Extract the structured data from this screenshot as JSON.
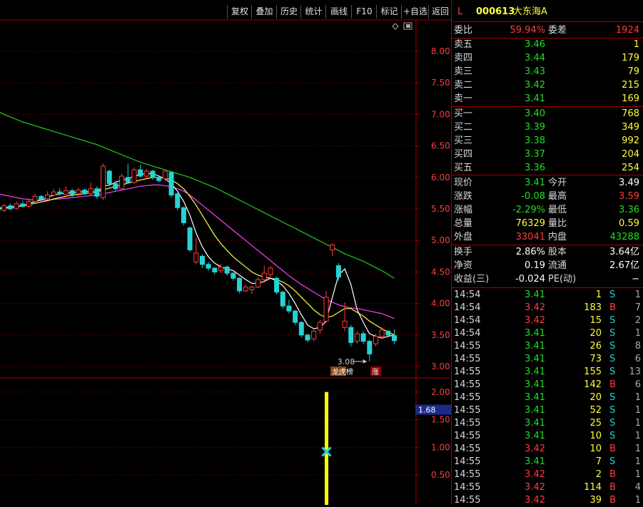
{
  "toolbar": {
    "buttons": [
      "复权",
      "叠加",
      "历史",
      "统计",
      "画线",
      "F10",
      "标记",
      "+自选",
      "返回"
    ]
  },
  "stock": {
    "flag": "L",
    "code": "000613",
    "name": "大东海A"
  },
  "order_ratio": {
    "label1": "委比",
    "value1": "59.94%",
    "label2": "委差",
    "value2": "1924"
  },
  "asks": [
    {
      "label": "卖五",
      "price": "3.46",
      "volume": "1"
    },
    {
      "label": "卖四",
      "price": "3.44",
      "volume": "179"
    },
    {
      "label": "卖三",
      "price": "3.43",
      "volume": "79"
    },
    {
      "label": "卖二",
      "price": "3.42",
      "volume": "215"
    },
    {
      "label": "卖一",
      "price": "3.41",
      "volume": "169"
    }
  ],
  "bids": [
    {
      "label": "买一",
      "price": "3.40",
      "volume": "768"
    },
    {
      "label": "买二",
      "price": "3.39",
      "volume": "349"
    },
    {
      "label": "买三",
      "price": "3.38",
      "volume": "992"
    },
    {
      "label": "买四",
      "price": "3.37",
      "volume": "204"
    },
    {
      "label": "买五",
      "price": "3.36",
      "volume": "254"
    }
  ],
  "stats1": [
    {
      "l1": "现价",
      "v1": "3.41",
      "c1": "green",
      "l2": "今开",
      "v2": "3.49",
      "c2": "white"
    },
    {
      "l1": "涨跌",
      "v1": "-0.08",
      "c1": "green",
      "l2": "最高",
      "v2": "3.59",
      "c2": "red"
    },
    {
      "l1": "涨幅",
      "v1": "-2.29%",
      "c1": "green",
      "l2": "最低",
      "v2": "3.36",
      "c2": "green"
    },
    {
      "l1": "总量",
      "v1": "76329",
      "c1": "yellow",
      "l2": "量比",
      "v2": "0.59",
      "c2": "yellow"
    },
    {
      "l1": "外盘",
      "v1": "33041",
      "c1": "red",
      "l2": "内盘",
      "v2": "43288",
      "c2": "green"
    }
  ],
  "stats2": [
    {
      "l1": "换手",
      "v1": "2.86%",
      "l2": "股本",
      "v2": "3.64亿"
    },
    {
      "l1": "净资",
      "v1": "0.19",
      "l2": "流通",
      "v2": "2.67亿"
    },
    {
      "l1": "收益(三)",
      "v1": "-0.024",
      "l2": "PE(动)",
      "v2": "−"
    }
  ],
  "ticks": [
    {
      "time": "14:54",
      "price": "3.41",
      "vol": "1",
      "side": "S",
      "n": "1"
    },
    {
      "time": "14:54",
      "price": "3.42",
      "vol": "183",
      "side": "B",
      "n": "7"
    },
    {
      "time": "14:54",
      "price": "3.42",
      "vol": "15",
      "side": "S",
      "n": "2"
    },
    {
      "time": "14:54",
      "price": "3.41",
      "vol": "20",
      "side": "S",
      "n": "1"
    },
    {
      "time": "14:55",
      "price": "3.41",
      "vol": "26",
      "side": "S",
      "n": "8"
    },
    {
      "time": "14:55",
      "price": "3.41",
      "vol": "73",
      "side": "S",
      "n": "6"
    },
    {
      "time": "14:55",
      "price": "3.41",
      "vol": "155",
      "side": "S",
      "n": "13"
    },
    {
      "time": "14:55",
      "price": "3.41",
      "vol": "142",
      "side": "B",
      "n": "6"
    },
    {
      "time": "14:55",
      "price": "3.41",
      "vol": "20",
      "side": "S",
      "n": "1"
    },
    {
      "time": "14:55",
      "price": "3.41",
      "vol": "52",
      "side": "S",
      "n": "1"
    },
    {
      "time": "14:55",
      "price": "3.41",
      "vol": "25",
      "side": "S",
      "n": "1"
    },
    {
      "time": "14:55",
      "price": "3.41",
      "vol": "10",
      "side": "S",
      "n": "1"
    },
    {
      "time": "14:55",
      "price": "3.42",
      "vol": "10",
      "side": "B",
      "n": "1"
    },
    {
      "time": "14:55",
      "price": "3.41",
      "vol": "7",
      "side": "S",
      "n": "1"
    },
    {
      "time": "14:55",
      "price": "3.42",
      "vol": "2",
      "side": "B",
      "n": "1"
    },
    {
      "time": "14:55",
      "price": "3.42",
      "vol": "114",
      "side": "B",
      "n": "4"
    },
    {
      "time": "14:55",
      "price": "3.42",
      "vol": "39",
      "side": "B",
      "n": "1"
    }
  ],
  "colors": {
    "up": "#ff3c3c",
    "down": "#27d2d2",
    "ma5": "#ffffff",
    "ma10": "#ffff3c",
    "ma20": "#ff3cff",
    "ma60": "#22cc22",
    "grid": "#a00000",
    "indicator": "#ffff00"
  },
  "chart_data": [
    {
      "type": "candlestick",
      "price_axis": {
        "ticks": [
          "8.00",
          "7.50",
          "7.00",
          "6.50",
          "6.00",
          "5.50",
          "5.00",
          "4.50",
          "4.00",
          "3.50",
          "3.00"
        ],
        "ylim": [
          2.9,
          8.3
        ]
      },
      "annotations": {
        "low_label": "3.08",
        "badge1": "龙虎榜",
        "badge2": "涨"
      },
      "candles": [
        {
          "o": 5.52,
          "c": 5.47,
          "h": 5.56,
          "l": 5.44
        },
        {
          "o": 5.48,
          "c": 5.55,
          "h": 5.58,
          "l": 5.45
        },
        {
          "o": 5.55,
          "c": 5.5,
          "h": 5.59,
          "l": 5.48
        },
        {
          "o": 5.51,
          "c": 5.58,
          "h": 5.62,
          "l": 5.49
        },
        {
          "o": 5.58,
          "c": 5.54,
          "h": 5.63,
          "l": 5.52
        },
        {
          "o": 5.54,
          "c": 5.62,
          "h": 5.66,
          "l": 5.52
        },
        {
          "o": 5.62,
          "c": 5.7,
          "h": 5.74,
          "l": 5.6
        },
        {
          "o": 5.7,
          "c": 5.65,
          "h": 5.72,
          "l": 5.6
        },
        {
          "o": 5.66,
          "c": 5.72,
          "h": 5.78,
          "l": 5.64
        },
        {
          "o": 5.72,
          "c": 5.77,
          "h": 5.82,
          "l": 5.7
        },
        {
          "o": 5.77,
          "c": 5.74,
          "h": 5.83,
          "l": 5.71
        },
        {
          "o": 5.73,
          "c": 5.79,
          "h": 5.86,
          "l": 5.7
        },
        {
          "o": 5.79,
          "c": 5.73,
          "h": 5.82,
          "l": 5.69
        },
        {
          "o": 5.74,
          "c": 5.8,
          "h": 5.84,
          "l": 5.7
        },
        {
          "o": 5.8,
          "c": 5.74,
          "h": 5.82,
          "l": 5.72
        },
        {
          "o": 5.74,
          "c": 5.82,
          "h": 5.92,
          "l": 5.72
        },
        {
          "o": 5.82,
          "c": 5.7,
          "h": 5.86,
          "l": 5.66
        },
        {
          "o": 5.68,
          "c": 6.18,
          "h": 6.22,
          "l": 5.64
        },
        {
          "o": 6.1,
          "c": 5.9,
          "h": 6.12,
          "l": 5.86
        },
        {
          "o": 5.9,
          "c": 5.82,
          "h": 5.95,
          "l": 5.78
        },
        {
          "o": 5.82,
          "c": 6.02,
          "h": 6.06,
          "l": 5.8
        },
        {
          "o": 6.0,
          "c": 5.92,
          "h": 6.22,
          "l": 5.9
        },
        {
          "o": 5.92,
          "c": 6.12,
          "h": 6.16,
          "l": 5.9
        },
        {
          "o": 6.12,
          "c": 6.02,
          "h": 6.2,
          "l": 6.0
        },
        {
          "o": 6.02,
          "c": 6.1,
          "h": 6.14,
          "l": 5.98
        },
        {
          "o": 6.1,
          "c": 6.0,
          "h": 6.12,
          "l": 5.96
        },
        {
          "o": 6.0,
          "c": 5.95,
          "h": 6.04,
          "l": 5.92
        },
        {
          "o": 5.98,
          "c": 6.1,
          "h": 6.12,
          "l": 5.94
        },
        {
          "o": 6.08,
          "c": 5.72,
          "h": 6.1,
          "l": 5.68
        },
        {
          "o": 5.74,
          "c": 5.52,
          "h": 5.76,
          "l": 5.48
        },
        {
          "o": 5.52,
          "c": 5.28,
          "h": 5.54,
          "l": 5.24
        },
        {
          "o": 5.2,
          "c": 4.85,
          "h": 5.22,
          "l": 4.82
        },
        {
          "o": 4.66,
          "c": 4.8,
          "h": 5.05,
          "l": 4.62
        },
        {
          "o": 4.75,
          "c": 4.62,
          "h": 4.78,
          "l": 4.56
        },
        {
          "o": 4.62,
          "c": 4.56,
          "h": 4.66,
          "l": 4.52
        },
        {
          "o": 4.56,
          "c": 4.5,
          "h": 4.58,
          "l": 4.46
        },
        {
          "o": 4.52,
          "c": 4.58,
          "h": 4.62,
          "l": 4.48
        },
        {
          "o": 4.58,
          "c": 4.48,
          "h": 4.6,
          "l": 4.44
        },
        {
          "o": 4.48,
          "c": 4.4,
          "h": 4.5,
          "l": 4.36
        },
        {
          "o": 4.4,
          "c": 4.2,
          "h": 4.42,
          "l": 4.16
        },
        {
          "o": 4.2,
          "c": 4.26,
          "h": 4.3,
          "l": 4.18
        },
        {
          "o": 4.22,
          "c": 4.26,
          "h": 4.28,
          "l": 4.15
        },
        {
          "o": 4.26,
          "c": 4.38,
          "h": 4.42,
          "l": 4.24
        },
        {
          "o": 4.38,
          "c": 4.48,
          "h": 4.6,
          "l": 4.36
        },
        {
          "o": 4.46,
          "c": 4.56,
          "h": 4.6,
          "l": 4.4
        },
        {
          "o": 4.4,
          "c": 4.18,
          "h": 4.42,
          "l": 4.14
        },
        {
          "o": 4.18,
          "c": 3.96,
          "h": 4.2,
          "l": 3.92
        },
        {
          "o": 3.96,
          "c": 3.88,
          "h": 4.06,
          "l": 3.84
        },
        {
          "o": 3.88,
          "c": 3.7,
          "h": 3.9,
          "l": 3.66
        },
        {
          "o": 3.7,
          "c": 3.5,
          "h": 3.72,
          "l": 3.46
        },
        {
          "o": 3.5,
          "c": 3.42,
          "h": 3.52,
          "l": 3.38
        },
        {
          "o": 3.44,
          "c": 3.56,
          "h": 3.6,
          "l": 3.4
        },
        {
          "o": 3.58,
          "c": 3.7,
          "h": 3.74,
          "l": 3.52
        },
        {
          "o": 3.72,
          "c": 4.1,
          "h": 4.2,
          "l": 3.7
        },
        {
          "o": 4.85,
          "c": 4.93,
          "h": 4.95,
          "l": 4.75
        },
        {
          "o": 4.6,
          "c": 4.42,
          "h": 4.64,
          "l": 4.36
        },
        {
          "o": 3.62,
          "c": 3.72,
          "h": 4.02,
          "l": 3.56
        },
        {
          "o": 3.62,
          "c": 3.38,
          "h": 3.66,
          "l": 3.32
        },
        {
          "o": 3.4,
          "c": 3.52,
          "h": 3.56,
          "l": 3.36
        },
        {
          "o": 3.52,
          "c": 3.4,
          "h": 3.56,
          "l": 3.36
        },
        {
          "o": 3.4,
          "c": 3.2,
          "h": 3.42,
          "l": 3.08
        },
        {
          "o": 3.36,
          "c": 3.48,
          "h": 3.52,
          "l": 3.32
        },
        {
          "o": 3.48,
          "c": 3.58,
          "h": 3.62,
          "l": 3.44
        },
        {
          "o": 3.56,
          "c": 3.5,
          "h": 3.58,
          "l": 3.46
        },
        {
          "o": 3.49,
          "c": 3.41,
          "h": 3.59,
          "l": 3.36
        }
      ],
      "ma5": [
        5.52,
        5.52,
        5.53,
        5.54,
        5.55,
        5.58,
        5.62,
        5.64,
        5.68,
        5.72,
        5.74,
        5.75,
        5.76,
        5.77,
        5.77,
        5.78,
        5.76,
        5.86,
        5.88,
        5.92,
        5.96,
        5.98,
        6.02,
        6.05,
        6.06,
        6.06,
        6.02,
        5.98,
        5.9,
        5.78,
        5.62,
        5.4,
        5.12,
        4.9,
        4.74,
        4.64,
        4.58,
        4.55,
        4.52,
        4.45,
        4.38,
        4.32,
        4.32,
        4.35,
        4.4,
        4.36,
        4.28,
        4.16,
        4.0,
        3.82,
        3.66,
        3.6,
        3.62,
        3.72,
        4.1,
        4.45,
        4.55,
        4.3,
        3.9,
        3.7,
        3.52,
        3.48,
        3.45,
        3.48,
        3.5
      ],
      "ma10": [
        5.5,
        5.51,
        5.52,
        5.53,
        5.55,
        5.57,
        5.59,
        5.61,
        5.63,
        5.66,
        5.68,
        5.7,
        5.72,
        5.73,
        5.74,
        5.76,
        5.77,
        5.8,
        5.83,
        5.86,
        5.88,
        5.91,
        5.93,
        5.96,
        5.98,
        6.0,
        6.0,
        5.99,
        5.96,
        5.9,
        5.82,
        5.7,
        5.56,
        5.4,
        5.24,
        5.08,
        4.95,
        4.84,
        4.74,
        4.66,
        4.58,
        4.5,
        4.45,
        4.42,
        4.4,
        4.38,
        4.34,
        4.28,
        4.2,
        4.1,
        4.0,
        3.9,
        3.82,
        3.78,
        3.8,
        3.86,
        3.92,
        3.92,
        3.86,
        3.8,
        3.72,
        3.66,
        3.6,
        3.55,
        3.5
      ],
      "ma20": [
        5.74,
        5.72,
        5.7,
        5.68,
        5.66,
        5.65,
        5.64,
        5.64,
        5.64,
        5.65,
        5.66,
        5.67,
        5.68,
        5.69,
        5.7,
        5.71,
        5.72,
        5.74,
        5.76,
        5.78,
        5.8,
        5.82,
        5.84,
        5.86,
        5.87,
        5.88,
        5.88,
        5.87,
        5.85,
        5.82,
        5.78,
        5.72,
        5.64,
        5.56,
        5.48,
        5.4,
        5.32,
        5.24,
        5.16,
        5.08,
        5.0,
        4.92,
        4.84,
        4.76,
        4.68,
        4.6,
        4.52,
        4.44,
        4.37,
        4.3,
        4.24,
        4.18,
        4.12,
        4.06,
        4.02,
        3.98,
        3.95,
        3.93,
        3.92,
        3.9,
        3.88,
        3.86,
        3.84,
        3.8,
        3.76
      ],
      "ma60": [
        7.05,
        7.0,
        6.96,
        6.92,
        6.88,
        6.85,
        6.82,
        6.79,
        6.76,
        6.73,
        6.7,
        6.67,
        6.64,
        6.61,
        6.58,
        6.55,
        6.52,
        6.48,
        6.44,
        6.4,
        6.36,
        6.32,
        6.28,
        6.24,
        6.21,
        6.18,
        6.15,
        6.12,
        6.09,
        6.06,
        6.03,
        6.0,
        5.96,
        5.92,
        5.88,
        5.84,
        5.79,
        5.74,
        5.69,
        5.64,
        5.59,
        5.54,
        5.49,
        5.44,
        5.39,
        5.34,
        5.29,
        5.24,
        5.19,
        5.14,
        5.09,
        5.04,
        4.99,
        4.94,
        4.89,
        4.84,
        4.79,
        4.75,
        4.71,
        4.67,
        4.62,
        4.57,
        4.52,
        4.46,
        4.4
      ]
    },
    {
      "type": "bar",
      "indicator_axis": {
        "ticks": [
          "2.00",
          "1.50",
          "1.00",
          "0.50"
        ],
        "ylim": [
          0,
          2.2
        ]
      },
      "current_value": "1.68",
      "bar": {
        "index": 53,
        "value": 2.0
      },
      "marker": {
        "index": 53,
        "value": 0.92
      }
    }
  ]
}
